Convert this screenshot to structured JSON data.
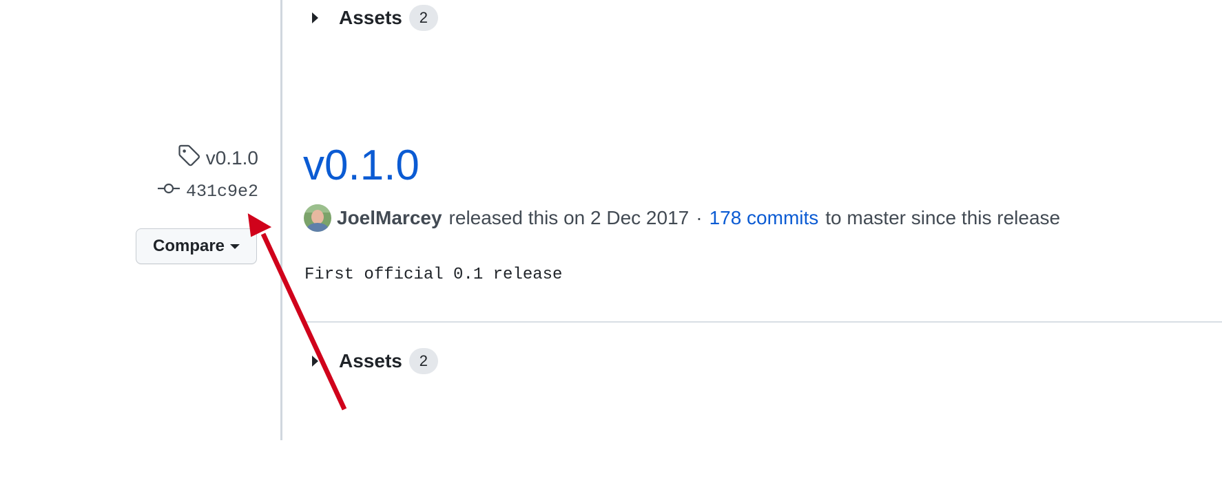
{
  "previous_release": {
    "assets_label": "Assets",
    "assets_count": "2"
  },
  "sidebar": {
    "tag": "v0.1.0",
    "commit": "431c9e2",
    "compare_label": "Compare",
    "icons": {
      "tag": "tag-icon",
      "commit": "git-commit-icon",
      "compare_dropdown": "chevron-down-icon"
    }
  },
  "release": {
    "title": "v0.1.0",
    "author": "JoelMarcey",
    "released_text": "released this on 2 Dec 2017",
    "separator": "·",
    "commits_link": "178 commits",
    "since_text": "to master since this release",
    "body": "First official 0.1 release",
    "assets_label": "Assets",
    "assets_count": "2"
  },
  "colors": {
    "link": "#0b5bd3",
    "annotation_arrow": "#d0021b"
  }
}
